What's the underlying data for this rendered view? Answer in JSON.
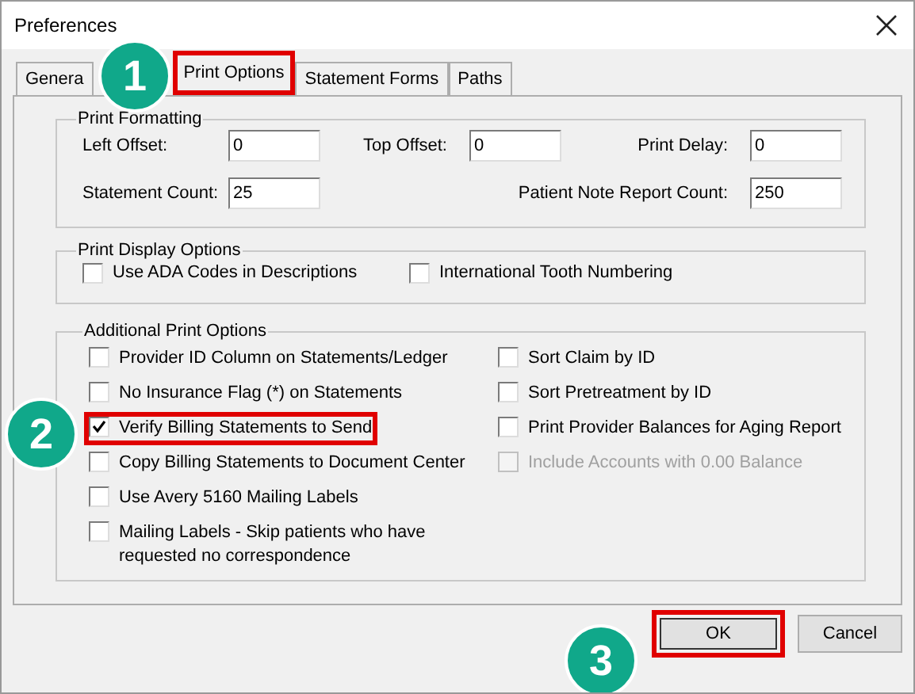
{
  "window": {
    "title": "Preferences"
  },
  "tabs": [
    {
      "label": "Genera",
      "selected": false,
      "highlighted": false
    },
    {
      "label": "Print Options",
      "selected": true,
      "highlighted": true
    },
    {
      "label": "Statement Forms",
      "selected": false,
      "highlighted": false
    },
    {
      "label": "Paths",
      "selected": false,
      "highlighted": false
    }
  ],
  "print_formatting": {
    "title": "Print Formatting",
    "fields": [
      {
        "label": "Left Offset:",
        "value": "0"
      },
      {
        "label": "Top Offset:",
        "value": "0"
      },
      {
        "label": "Print Delay:",
        "value": "0"
      },
      {
        "label": "Statement Count:",
        "value": "25"
      },
      {
        "label": "Patient Note Report Count:",
        "value": "250"
      }
    ]
  },
  "print_display_options": {
    "title": "Print Display Options",
    "options": [
      {
        "label": "Use ADA Codes in Descriptions",
        "checked": false
      },
      {
        "label": "International Tooth Numbering",
        "checked": false
      }
    ]
  },
  "additional_print_options": {
    "title": "Additional Print Options",
    "columns": [
      [
        {
          "label": "Provider ID Column on Statements/Ledger",
          "checked": false,
          "disabled": false,
          "highlighted": false
        },
        {
          "label": "No Insurance Flag (*) on Statements",
          "checked": false,
          "disabled": false,
          "highlighted": false
        },
        {
          "label": "Verify Billing Statements to Send",
          "checked": true,
          "disabled": false,
          "highlighted": true
        },
        {
          "label": "Copy Billing Statements to Document Center",
          "checked": false,
          "disabled": false,
          "highlighted": false
        },
        {
          "label": "Use Avery 5160 Mailing Labels",
          "checked": false,
          "disabled": false,
          "highlighted": false
        },
        {
          "label": "Mailing Labels - Skip patients who have requested no correspondence",
          "checked": false,
          "disabled": false,
          "highlighted": false
        }
      ],
      [
        {
          "label": "Sort Claim by ID",
          "checked": false,
          "disabled": false,
          "highlighted": false
        },
        {
          "label": "Sort Pretreatment by ID",
          "checked": false,
          "disabled": false,
          "highlighted": false
        },
        {
          "label": "Print Provider Balances for Aging Report",
          "checked": false,
          "disabled": false,
          "highlighted": false
        },
        {
          "label": "Include Accounts with 0.00 Balance",
          "checked": false,
          "disabled": true,
          "highlighted": false
        }
      ]
    ]
  },
  "buttons": [
    {
      "label": "OK",
      "highlighted": true
    },
    {
      "label": "Cancel",
      "highlighted": false
    }
  ],
  "callouts": [
    {
      "number": "1"
    },
    {
      "number": "2"
    },
    {
      "number": "3"
    }
  ]
}
